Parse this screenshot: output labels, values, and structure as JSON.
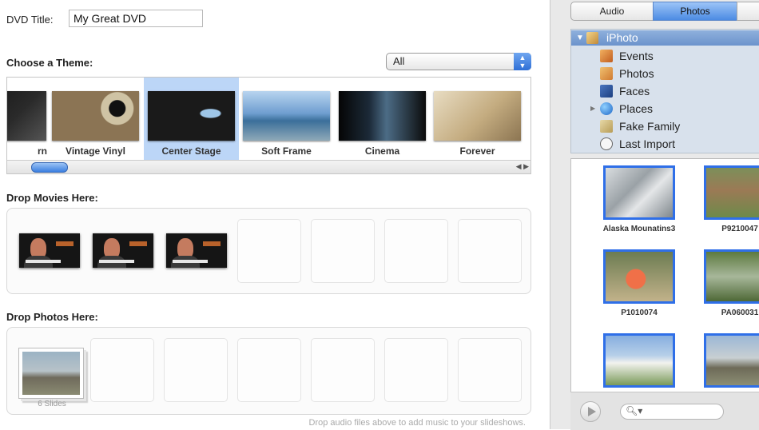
{
  "dvd": {
    "title_label": "DVD Title:",
    "title_value": "My Great DVD"
  },
  "theme": {
    "header": "Choose a Theme:",
    "filter_value": "All",
    "items": [
      {
        "label": "rn",
        "selected": false
      },
      {
        "label": "Vintage Vinyl",
        "selected": false
      },
      {
        "label": "Center Stage",
        "selected": true
      },
      {
        "label": "Soft Frame",
        "selected": false
      },
      {
        "label": "Cinema",
        "selected": false
      },
      {
        "label": "Forever",
        "selected": false
      }
    ]
  },
  "movies": {
    "header": "Drop Movies Here:",
    "count": 3
  },
  "photos": {
    "header": "Drop Photos Here:",
    "slides_label": "6 Slides"
  },
  "hint": "Drop audio files above to add music to your slideshows.",
  "media": {
    "tabs": [
      {
        "label": "Audio",
        "active": false
      },
      {
        "label": "Photos",
        "active": true
      },
      {
        "label": "",
        "active": false
      }
    ],
    "sources": {
      "root": "iPhoto",
      "items": [
        "Events",
        "Photos",
        "Faces",
        "Places",
        "Fake Family",
        "Last Import"
      ]
    },
    "photos": [
      "Alaska Mounatins3",
      "P9210047",
      "P1010074",
      "PA060031",
      "",
      ""
    ]
  },
  "icons": {
    "play": "play-icon",
    "search": "search-icon",
    "disclosure": "triangle-down-icon",
    "scroll_left": "arrow-left-icon",
    "scroll_right": "arrow-right-icon"
  },
  "colors": {
    "selection": "#bcd6f7",
    "accent": "#2f6fe8",
    "source_bg": "#d8e1ec"
  }
}
